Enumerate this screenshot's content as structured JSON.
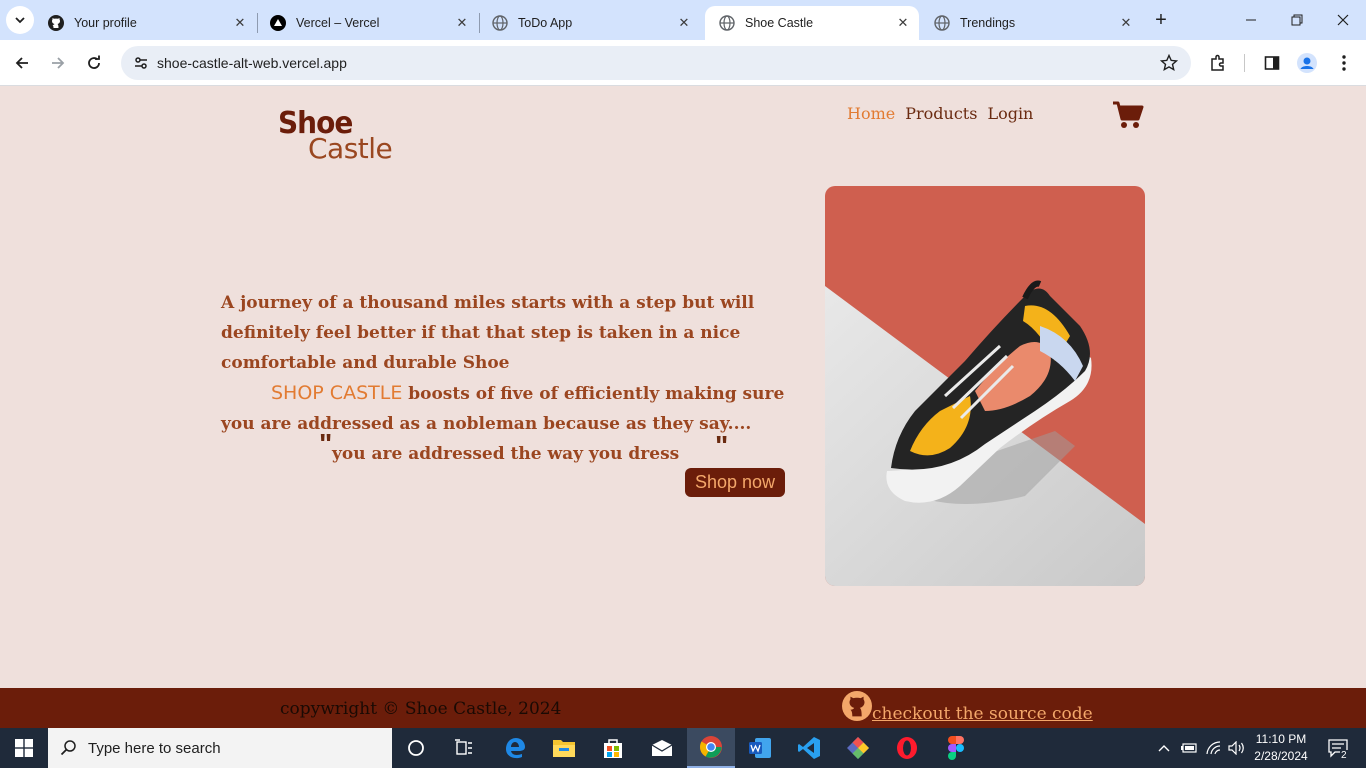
{
  "browser": {
    "tabs": [
      {
        "title": "Your profile",
        "icon": "github-icon"
      },
      {
        "title": "Vercel – Vercel",
        "icon": "vercel-icon"
      },
      {
        "title": "ToDo App",
        "icon": "globe-icon"
      },
      {
        "title": "Shoe Castle",
        "icon": "globe-icon",
        "active": true
      },
      {
        "title": "Trendings",
        "icon": "globe-icon"
      }
    ],
    "url": "shoe-castle-alt-web.vercel.app"
  },
  "site": {
    "logo_line1": "Shoe",
    "logo_line2": "Castle",
    "nav": [
      "Home",
      "Products",
      "Login"
    ],
    "hero_paragraph": "A journey of a thousand miles starts with a step but will definitely feel better if that that step is taken in a nice comfortable and durable Shoe",
    "brand_inline": "SHOP CASTLE",
    "hero_paragraph2": " boosts of five of efficiently making sure you are addressed as a nobleman because as they say....",
    "quote_open": "\"",
    "quote_text": "you are addressed the way you dress",
    "quote_close": "\"",
    "cta": "Shop now",
    "footer_copyright": "copywright © Shoe Castle, 2024",
    "footer_link": "checkout the source code"
  },
  "taskbar": {
    "search_placeholder": "Type here to search",
    "time": "11:10 PM",
    "date": "2/28/2024",
    "notifications": "2"
  },
  "colors": {
    "page_bg": "#efe0dc",
    "brand_dark": "#6b1d0a",
    "text_brown": "#9b4620",
    "accent_orange": "#e27b32",
    "image_coral": "#cf5f4f"
  }
}
